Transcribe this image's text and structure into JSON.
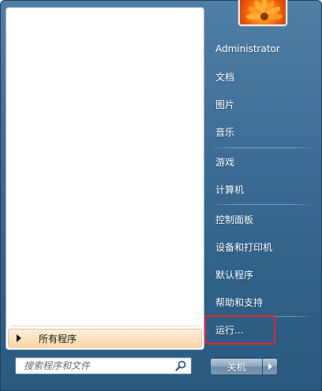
{
  "left_pane": {
    "all_programs_label": "所有程序"
  },
  "search": {
    "placeholder": "搜索程序和文件"
  },
  "user": {
    "picture": "orange-flower-avatar"
  },
  "right_pane": {
    "items": [
      {
        "label": "Administrator"
      },
      {
        "label": "文档"
      },
      {
        "label": "图片"
      },
      {
        "label": "音乐"
      },
      {
        "label": "游戏"
      },
      {
        "label": "计算机"
      },
      {
        "label": "控制面板"
      },
      {
        "label": "设备和打印机"
      },
      {
        "label": "默认程序"
      },
      {
        "label": "帮助和支持"
      },
      {
        "label": "运行..."
      }
    ]
  },
  "shutdown": {
    "label": "关机"
  },
  "colors": {
    "highlight_border": "#e8262b",
    "menu_background": "#3f6f98",
    "all_programs_background": "#fbe3bf"
  }
}
